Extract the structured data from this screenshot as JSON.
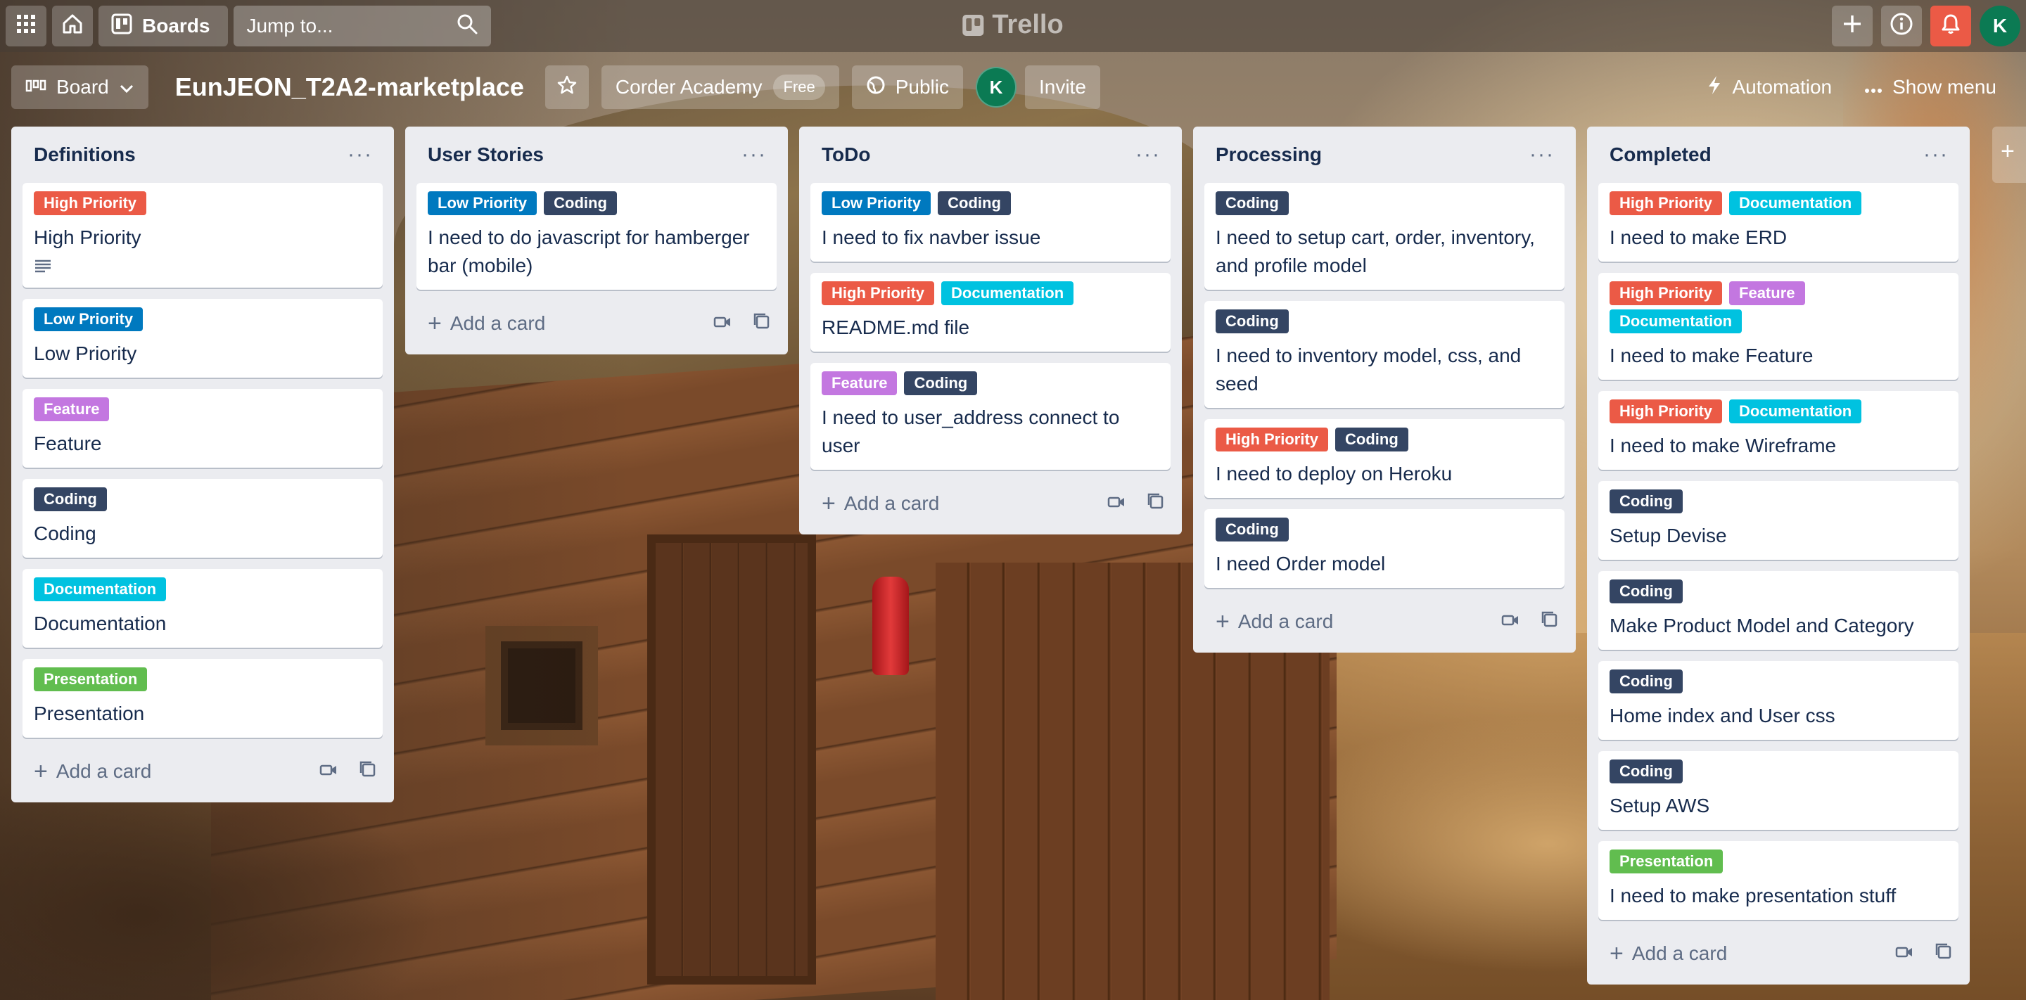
{
  "header": {
    "boards_label": "Boards",
    "search_placeholder": "Jump to...",
    "logo_text": "Trello",
    "avatar_initial": "K"
  },
  "board": {
    "view_label": "Board",
    "title": "EunJEON_T2A2-marketplace",
    "workspace": "Corder Academy",
    "plan_badge": "Free",
    "visibility": "Public",
    "member_initial": "K",
    "invite_label": "Invite",
    "automation_label": "Automation",
    "show_menu_label": "Show menu"
  },
  "label_colors": {
    "High Priority": "#eb5a46",
    "Low Priority": "#0079bf",
    "Feature": "#c377e0",
    "Coding": "#344563",
    "Documentation": "#00c2e0",
    "Presentation": "#61bd4f"
  },
  "add_card_label": "Add a card",
  "lists": [
    {
      "title": "Definitions",
      "cards": [
        {
          "labels": [
            "High Priority"
          ],
          "text": "High Priority",
          "has_description": true
        },
        {
          "labels": [
            "Low Priority"
          ],
          "text": "Low Priority"
        },
        {
          "labels": [
            "Feature"
          ],
          "text": "Feature"
        },
        {
          "labels": [
            "Coding"
          ],
          "text": "Coding"
        },
        {
          "labels": [
            "Documentation"
          ],
          "text": "Documentation"
        },
        {
          "labels": [
            "Presentation"
          ],
          "text": "Presentation"
        }
      ]
    },
    {
      "title": "User Stories",
      "cards": [
        {
          "labels": [
            "Low Priority",
            "Coding"
          ],
          "text": "I need to do javascript for hamberger bar (mobile)"
        }
      ]
    },
    {
      "title": "ToDo",
      "cards": [
        {
          "labels": [
            "Low Priority",
            "Coding"
          ],
          "text": "I need to fix navber issue"
        },
        {
          "labels": [
            "High Priority",
            "Documentation"
          ],
          "text": "README.md file"
        },
        {
          "labels": [
            "Feature",
            "Coding"
          ],
          "text": "I need to user_address connect to user"
        }
      ]
    },
    {
      "title": "Processing",
      "cards": [
        {
          "labels": [
            "Coding"
          ],
          "text": "I need to setup cart, order, inventory, and profile model"
        },
        {
          "labels": [
            "Coding"
          ],
          "text": "I need to inventory model, css, and seed"
        },
        {
          "labels": [
            "High Priority",
            "Coding"
          ],
          "text": "I need to deploy on Heroku"
        },
        {
          "labels": [
            "Coding"
          ],
          "text": "I need Order model"
        }
      ]
    },
    {
      "title": "Completed",
      "cards": [
        {
          "labels": [
            "High Priority",
            "Documentation"
          ],
          "text": "I need to make ERD"
        },
        {
          "labels": [
            "High Priority",
            "Feature",
            "Documentation"
          ],
          "text": "I need to make Feature"
        },
        {
          "labels": [
            "High Priority",
            "Documentation"
          ],
          "text": "I need to make Wireframe"
        },
        {
          "labels": [
            "Coding"
          ],
          "text": "Setup Devise"
        },
        {
          "labels": [
            "Coding"
          ],
          "text": "Make Product Model and Category"
        },
        {
          "labels": [
            "Coding"
          ],
          "text": "Home index and User css"
        },
        {
          "labels": [
            "Coding"
          ],
          "text": "Setup AWS"
        },
        {
          "labels": [
            "Presentation"
          ],
          "text": "I need to make presentation stuff"
        }
      ]
    }
  ],
  "icons": {
    "apps": "apps-grid-icon",
    "home": "home-icon",
    "boards": "boards-icon",
    "search": "search-icon",
    "create": "plus-icon",
    "info": "info-icon",
    "notifications": "bell-icon",
    "star": "star-icon",
    "visibility": "globe-icon",
    "automation": "lightning-icon",
    "menu": "more-icon"
  }
}
